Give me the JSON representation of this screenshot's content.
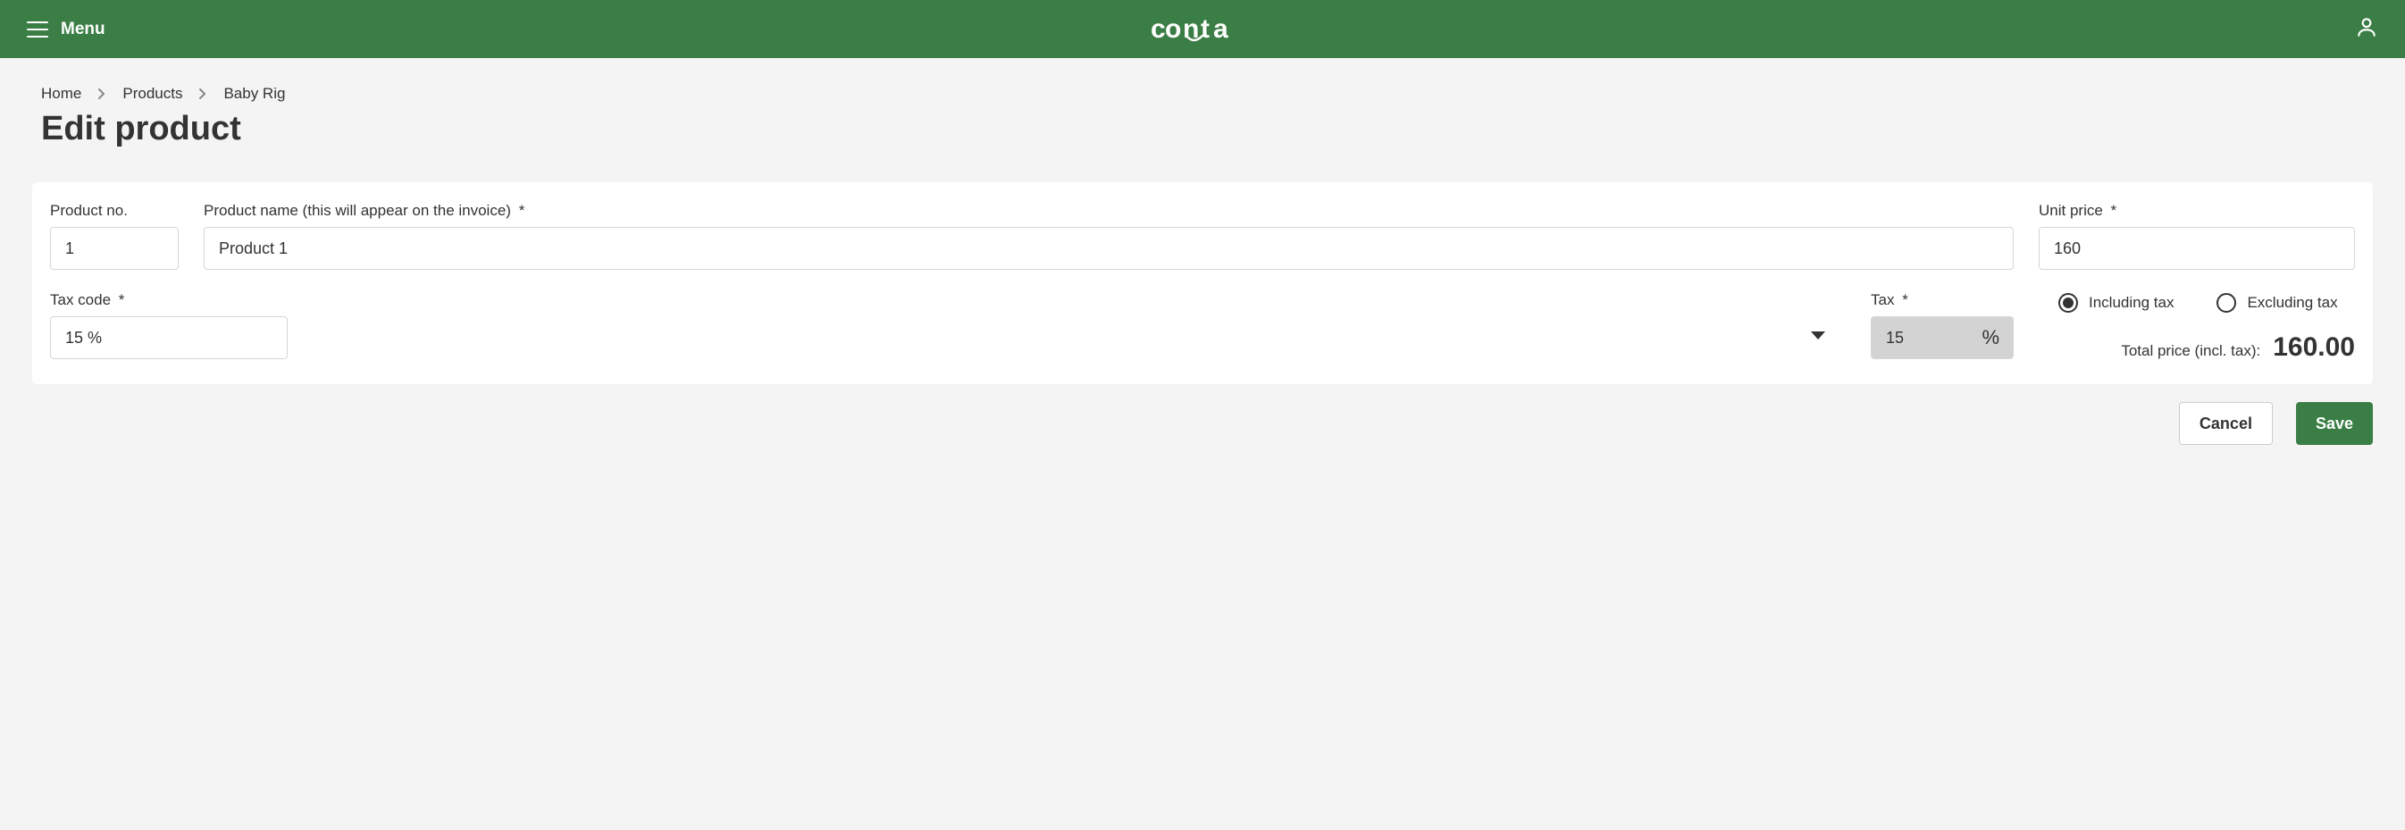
{
  "header": {
    "menu_label": "Menu",
    "brand": "conta"
  },
  "breadcrumbs": {
    "items": [
      "Home",
      "Products",
      "Baby Rig"
    ]
  },
  "page_title": "Edit product",
  "form": {
    "product_no_label": "Product no.",
    "product_no_value": "1",
    "product_name_label": "Product name (this will appear on the invoice)",
    "product_name_value": "Product 1",
    "unit_price_label": "Unit price",
    "unit_price_value": "160",
    "tax_code_label": "Tax code",
    "tax_code_value": "15 %",
    "tax_label": "Tax",
    "tax_value": "15",
    "including_tax_label": "Including tax",
    "excluding_tax_label": "Excluding tax",
    "tax_mode_selected": "including",
    "total_label": "Total price (incl. tax):",
    "total_value": "160.00"
  },
  "actions": {
    "cancel_label": "Cancel",
    "save_label": "Save"
  }
}
